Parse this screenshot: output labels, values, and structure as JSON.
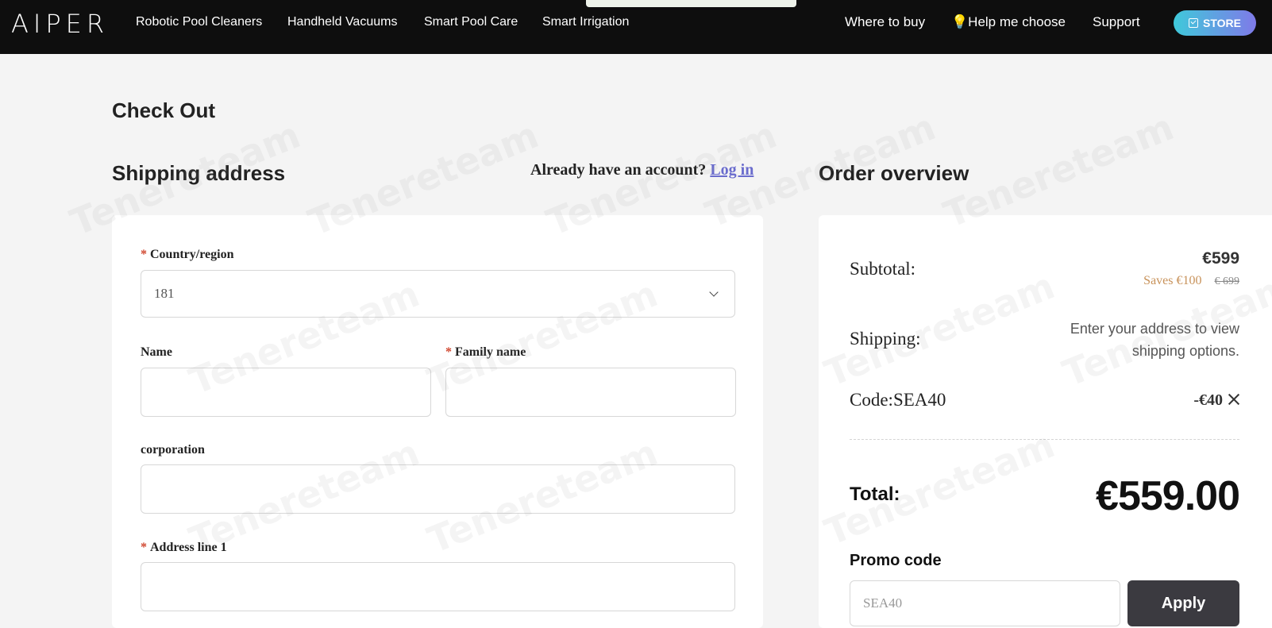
{
  "header": {
    "logo": "AIPER",
    "nav": [
      {
        "label": "Robotic Pool Cleaners"
      },
      {
        "label": "Handheld Vacuums"
      },
      {
        "label": "Smart Pool Care"
      },
      {
        "label": "Smart Irrigation"
      }
    ],
    "right_links": {
      "where_to_buy": "Where to buy",
      "help_choose": "💡Help me choose",
      "support": "Support",
      "store": "STORE"
    },
    "store_gradient": [
      "#3fc9da",
      "#7f7ae8"
    ]
  },
  "watermark_text": "Tenereteam",
  "page": {
    "title": "Check Out"
  },
  "shipping": {
    "title": "Shipping address",
    "account_prompt": "Already have an account?",
    "login_link": "Log in",
    "fields": {
      "country": {
        "label": "Country/region",
        "value": "181",
        "required": true
      },
      "name": {
        "label": "Name",
        "value": "",
        "required": false
      },
      "family_name": {
        "label": "Family name",
        "value": "",
        "required": true
      },
      "corporation": {
        "label": "corporation",
        "value": "",
        "required": false
      },
      "address1": {
        "label": "Address line 1",
        "value": "",
        "required": true
      }
    }
  },
  "overview": {
    "title": "Order overview",
    "subtotal_label": "Subtotal:",
    "subtotal_value": "€599",
    "saves_text": "Saves €100",
    "original_price": "€ 699",
    "shipping_label": "Shipping:",
    "shipping_note": "Enter your address to view shipping options.",
    "code_label": "Code:SEA40",
    "code_value": "-€40",
    "total_label": "Total:",
    "total_value": "€559.00",
    "promo_title": "Promo code",
    "promo_value": "SEA40",
    "apply_label": "Apply"
  },
  "colors": {
    "header_bg": "#0e0e0e",
    "page_bg": "#f4f4f4",
    "link": "#6a6ccd",
    "required": "#d0452d",
    "saves": "#c8925a",
    "apply_bg": "#3b3a40"
  }
}
